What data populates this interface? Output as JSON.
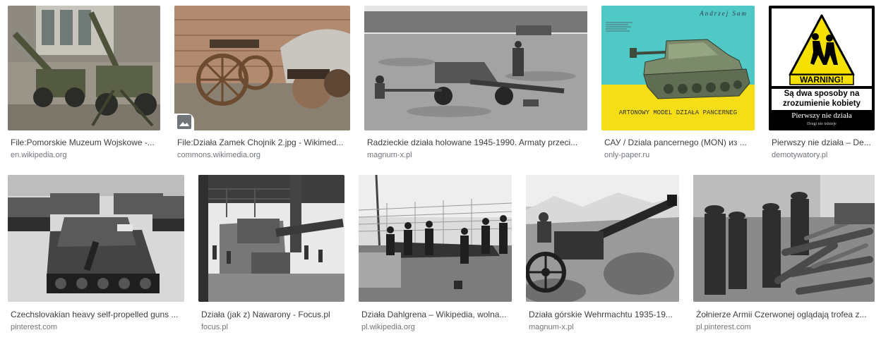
{
  "results": [
    {
      "title": "File:Pomorskie Muzeum Wojskowe -...",
      "source": "en.wikipedia.org",
      "icon": "artillery-photo"
    },
    {
      "title": "File:Działa Zamek Chojnik 2.jpg - Wikimed...",
      "source": "commons.wikimedia.org",
      "icon": "cannon-photo",
      "badge_icon": "image-icon"
    },
    {
      "title": "Radzieckie działa holowane 1945-1990. Armaty przeci...",
      "source": "magnum-x.pl",
      "icon": "field-gun-photo"
    },
    {
      "title": "САУ / Dziala pancernego (MON) из ...",
      "source": "only-paper.ru",
      "icon": "paper-model-cover"
    },
    {
      "title": "Pierwszy nie działa – De...",
      "source": "demotywatory.pl",
      "icon": "demotivator-poster"
    },
    {
      "title": "Czechslovakian heavy self-propelled guns ...",
      "source": "pinterest.com",
      "icon": "self-propelled-guns-photo"
    },
    {
      "title": "Działa (jak z) Nawarony - Focus.pl",
      "source": "focus.pl",
      "icon": "naval-gun-photo"
    },
    {
      "title": "Działa Dahlgrena – Wikipedia, wolna...",
      "source": "pl.wikipedia.org",
      "icon": "dahlgren-gun-photo"
    },
    {
      "title": "Działa górskie Wehrmachtu 1935-19...",
      "source": "magnum-x.pl",
      "icon": "mountain-gun-photo"
    },
    {
      "title": "Żołnierze Armii Czerwonej oglądają trofea z...",
      "source": "pl.pinterest.com",
      "icon": "soldiers-trophies-photo"
    }
  ],
  "poster": {
    "warning_label": "WARNING!",
    "line1": "Są dwa sposoby na",
    "line2": "zrozumienie kobiety",
    "caption": "Pierwszy nie działa",
    "subcaption": "Drugi nie istnieje"
  },
  "book": {
    "author": "Andrzej Sam",
    "caption": "ARTONOWY MODEL DZIAŁA PANCERNEG"
  }
}
